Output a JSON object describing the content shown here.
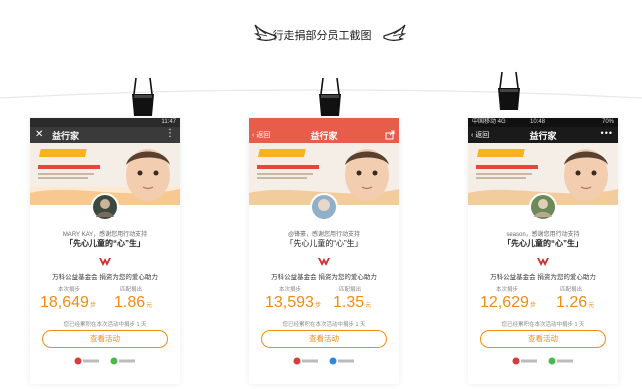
{
  "page_title": "行走捐部分员工截图",
  "phones": [
    {
      "status": {
        "time": "11:47",
        "left": ""
      },
      "nav": {
        "title": "益行家",
        "left_icon": "close-icon",
        "right_icon": "more-vertical-icon",
        "bg": "#3a3a3a"
      },
      "supporter": "MARY KAY，感谢您用行动支持",
      "slogan": "「先心儿童的“心”生」",
      "donation": "万科公益基金会 捐资为您的爱心助力",
      "steps_label": "本次捐步",
      "steps": "18,649",
      "steps_unit": "步",
      "amount_label": "匹配捐出",
      "amount": "1.86",
      "amount_unit": "元",
      "note": "您已经累积在本次活动中捐步 1 天",
      "button": "查看活动"
    },
    {
      "status": {
        "time": "",
        "left": ""
      },
      "nav": {
        "title": "益行家",
        "left": "返回",
        "right_icon": "share-icon",
        "bg": "#e85c4a"
      },
      "supporter": "@锋豪，感谢您用行动支持",
      "slogan": "「先心儿童的“心”生」",
      "donation": "万科公益基金会 捐资为您的爱心助力",
      "steps_label": "本次捐步",
      "steps": "13,593",
      "steps_unit": "步",
      "amount_label": "匹配捐出",
      "amount": "1.35",
      "amount_unit": "元",
      "note": "您已经累积在本次活动中捐步 1 天",
      "button": "查看活动"
    },
    {
      "status": {
        "time": "10:48",
        "left": "中国移动  4G",
        "right": "70%"
      },
      "nav": {
        "title": "益行家",
        "left": "返回",
        "right_icon": "more-horizontal-icon",
        "bg": "#1a1a1a"
      },
      "supporter": "season，感谢您用行动支持",
      "slogan": "「先心儿童的“心”生」",
      "donation": "万科公益基金会 捐资为您的爱心助力",
      "steps_label": "本次捐步",
      "steps": "12,629",
      "steps_unit": "步",
      "amount_label": "匹配捐出",
      "amount": "1.26",
      "amount_unit": "元",
      "note": "您已经累积在本次活动中捐步 1 天",
      "button": "查看活动"
    }
  ],
  "colors": {
    "accent": "#f08c14",
    "banner_ribbon": "#f7b21e"
  }
}
